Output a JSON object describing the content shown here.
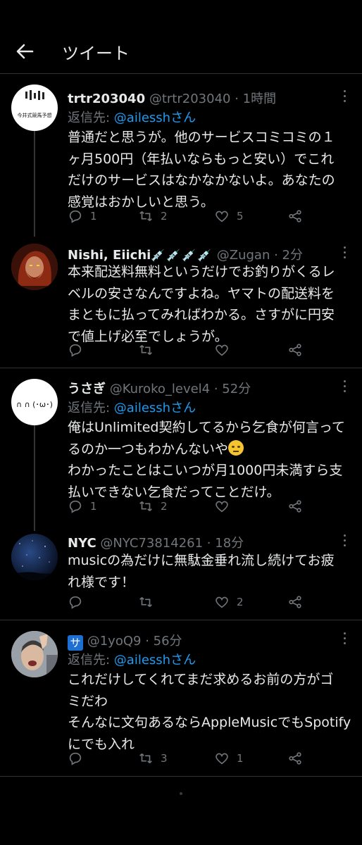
{
  "header": {
    "title": "ツイート",
    "back_icon": "arrow-left-icon"
  },
  "tweets": [
    {
      "name": "trtr203040",
      "handle": "@trtr203040",
      "time": "1時間",
      "avatar_label": "今井式競馬予想",
      "reply_prefix": "返信先: ",
      "reply_handle": "@ailesshさん",
      "lines": [
        "普通だと思うが。他のサービスコミコミの１",
        "ヶ月500円（年払いならもっと安い）でこれ",
        "だけのサービスはなかなかないよ。あなたの",
        "感覚はおかしいと思う。"
      ],
      "reply_count": "1",
      "retweet_count": "2",
      "like_count": "5"
    },
    {
      "name": "Nishi, Eiichi",
      "name_decoration": "💉💉💉💉",
      "handle": "@Zugan",
      "time": "2分",
      "lines": [
        "本来配送料無料というだけでお釣りがくるレ",
        "ベルの安さなんですよね。ヤマトの配送料を",
        "まともに払ってみればわかる。さすがに円安",
        "で値上げ必至でしょうが。"
      ],
      "reply_count": "",
      "retweet_count": "",
      "like_count": ""
    },
    {
      "name": "うさぎ",
      "handle": "@Kuroko_level4",
      "time": "52分",
      "avatar_label": "∩ ∩ (･ω･)",
      "reply_prefix": "返信先: ",
      "reply_handle": "@ailesshさん",
      "lines": [
        "俺はUnlimited契約してるから乞食が何言って",
        "るのか一つもわかんないや",
        "わかったことはこいつが月1000円未満すら支",
        "払いできない乞食だってことだけ。"
      ],
      "reply_count": "1",
      "retweet_count": "2",
      "like_count": ""
    },
    {
      "name": "NYC",
      "handle": "@NYC73814261",
      "time": "18分",
      "lines": [
        "musicの為だけに無駄金垂れ流し続けてお疲",
        "れ様です！"
      ],
      "reply_count": "",
      "retweet_count": "",
      "like_count": "2"
    },
    {
      "badge": "サ",
      "handle": "@1yoQ9",
      "time": "56分",
      "reply_prefix": "返信先: ",
      "reply_handle": "@ailesshさん",
      "lines": [
        "これだけしてくれてまだ求めるお前の方がゴ",
        "ミだわ",
        "そんなに文句あるならAppleMusicでもSpotify",
        "にでも入れ"
      ],
      "reply_count": "",
      "retweet_count": "3",
      "like_count": "1"
    }
  ],
  "separator": " · ",
  "colors": {
    "background": "#000000",
    "text": "#e7e9ea",
    "muted": "#71767b",
    "link": "#1d9bf0",
    "divider": "#2f3336"
  }
}
